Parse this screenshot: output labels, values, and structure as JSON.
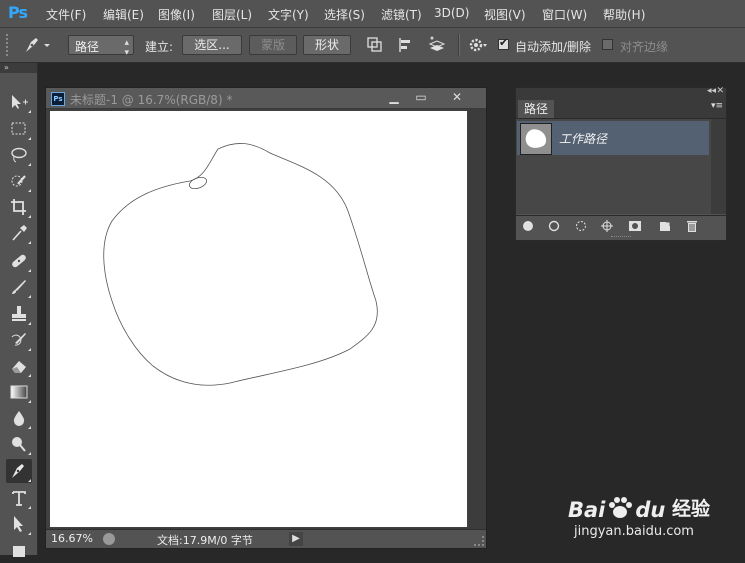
{
  "app": {
    "logo": "Ps"
  },
  "menu": [
    "文件(F)",
    "编辑(E)",
    "图像(I)",
    "图层(L)",
    "文字(Y)",
    "选择(S)",
    "滤镜(T)",
    "3D(D)",
    "视图(V)",
    "窗口(W)",
    "帮助(H)"
  ],
  "options": {
    "mode": "路径",
    "make_label": "建立:",
    "selection_btn": "选区...",
    "mask_btn": "蒙版",
    "shape_btn": "形状",
    "auto_add_delete": "自动添加/删除",
    "auto_add_delete_checked": true,
    "align_edges": "对齐边缘",
    "align_edges_checked": false
  },
  "document": {
    "title": "未标题-1 @ 16.7%(RGB/8) *",
    "icon": "Ps",
    "zoom": "16.67%",
    "info": "文档:17.9M/0 字节"
  },
  "paths_panel": {
    "tab": "路径",
    "items": [
      {
        "name": "工作路径",
        "selected": true
      }
    ]
  },
  "watermark": {
    "logo": "Bai",
    "logo_suffix": "du",
    "label": "经验",
    "url": "jingyan.baidu.com"
  },
  "colors": {
    "selection": "#536172",
    "menubar": "#535353",
    "workspace": "#282828"
  }
}
